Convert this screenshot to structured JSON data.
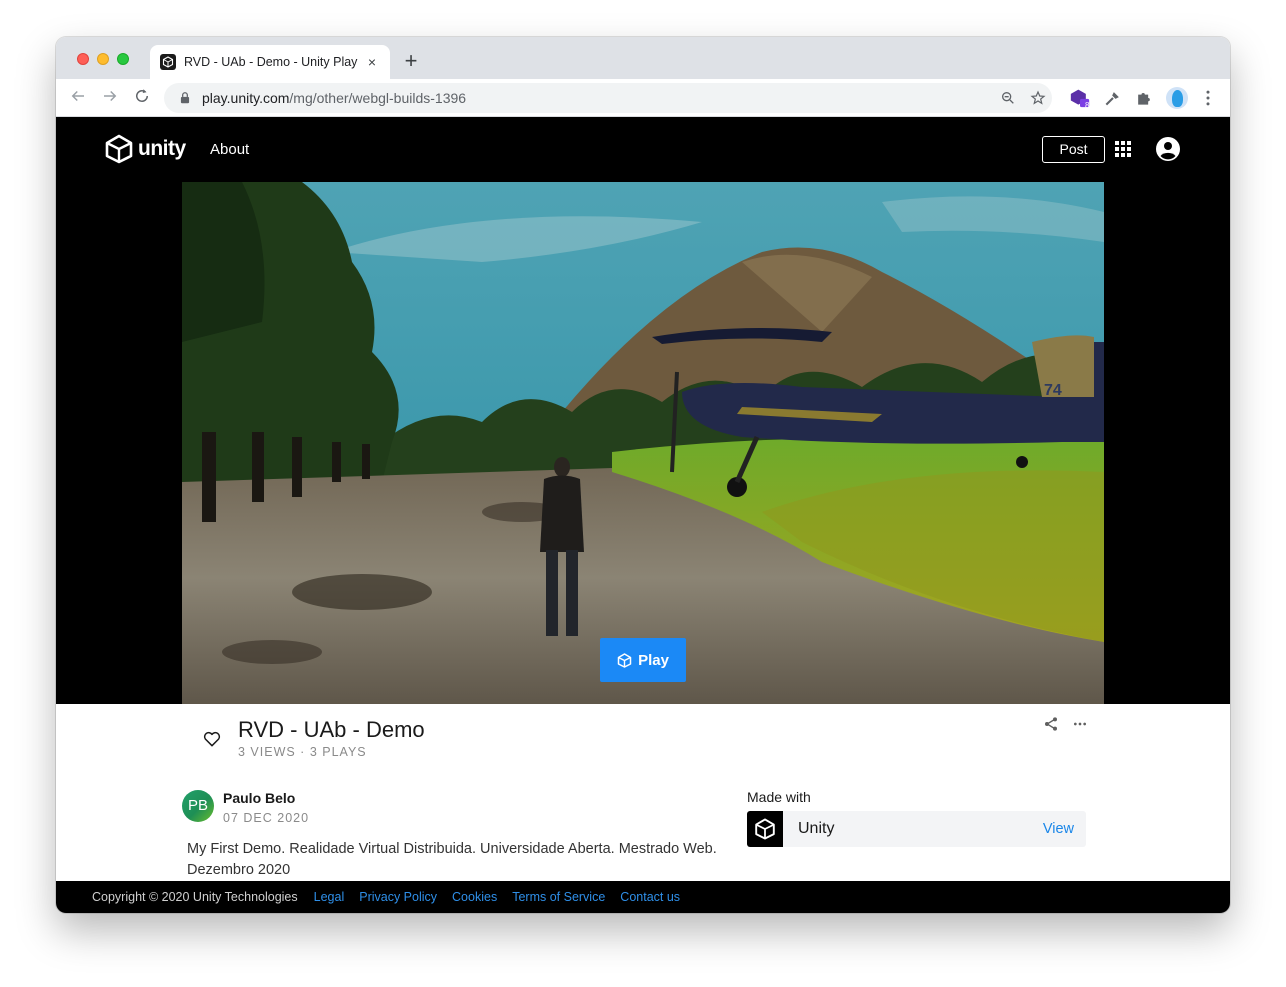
{
  "browser": {
    "tab_title": "RVD - UAb - Demo - Unity Play",
    "tab_close": "×",
    "new_tab": "+",
    "url_host": "play.unity.com",
    "url_path": "/mg/other/webgl-builds-1396",
    "extension_badge": "8"
  },
  "header": {
    "logo_text": "unity",
    "nav_about": "About",
    "post_label": "Post"
  },
  "game": {
    "play_label": "Play",
    "title": "RVD - UAb - Demo",
    "stats": "3 VIEWS · 3 PLAYS",
    "plane_number": "74"
  },
  "author": {
    "initials": "PB",
    "name": "Paulo Belo",
    "date": "07 DEC 2020",
    "description": "My First Demo. Realidade Virtual Distribuida. Universidade Aberta. Mestrado Web. Dezembro 2020"
  },
  "made_with": {
    "label": "Made with",
    "engine": "Unity",
    "view_label": "View"
  },
  "footer": {
    "copyright": "Copyright © 2020 Unity Technologies",
    "links": [
      "Legal",
      "Privacy Policy",
      "Cookies",
      "Terms of Service",
      "Contact us"
    ]
  },
  "colors": {
    "play_button": "#1b89f6",
    "link": "#2f8fe8",
    "header_bg": "#000000"
  }
}
